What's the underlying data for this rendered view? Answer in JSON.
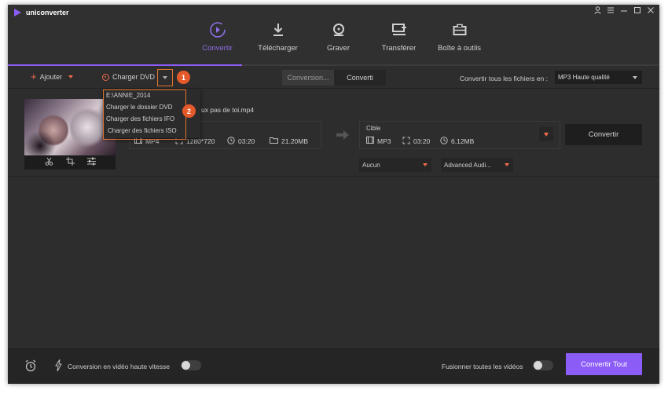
{
  "app": {
    "title": "uniconverter"
  },
  "window_controls": [
    "account-icon",
    "menu-icon",
    "minimize-icon",
    "maximize-icon",
    "close-icon"
  ],
  "nav": {
    "tabs": [
      {
        "label": "Convertir",
        "icon": "convert-icon",
        "active": true
      },
      {
        "label": "Télécharger",
        "icon": "download-icon",
        "active": false
      },
      {
        "label": "Graver",
        "icon": "burn-disc-icon",
        "active": false
      },
      {
        "label": "Transférer",
        "icon": "transfer-icon",
        "active": false
      },
      {
        "label": "Boîte à outils",
        "icon": "toolbox-icon",
        "active": false
      }
    ]
  },
  "toolbar": {
    "add_label": "Ajouter",
    "load_dvd_label": "Charger DVD",
    "segment": [
      "Conversion...",
      "Converti"
    ],
    "convert_all_to_label": "Convertir tous les fichiers en :",
    "format_value": "MP3 Haute qualité"
  },
  "dropdown_menu": {
    "items": [
      "E:\\ANNIE_2014",
      "Charger le dossier DVD",
      "Charger des fichiers IFO",
      "Charger des fichiers ISO"
    ]
  },
  "badges": [
    "1",
    "2"
  ],
  "file": {
    "name": "ux pas de toi.mp4",
    "source": {
      "format": "MP4",
      "resolution": "1280*720",
      "duration": "03:20",
      "size": "21.20MB"
    },
    "target": {
      "label": "Cible",
      "format": "MP3",
      "duration": "03:20",
      "size": "6.12MB"
    },
    "convert_label": "Convertir",
    "subtitle_select": "Aucun",
    "audio_select": "Advanced Audi..."
  },
  "bottom": {
    "high_speed_label": "Conversion en vidéo haute vitesse",
    "merge_label": "Fusionner toutes les vidéos",
    "convert_all_label": "Convertir Tout"
  },
  "colors": {
    "accent": "#8b5cf6",
    "highlight": "#e3742f",
    "orange": "#f26b4b"
  }
}
